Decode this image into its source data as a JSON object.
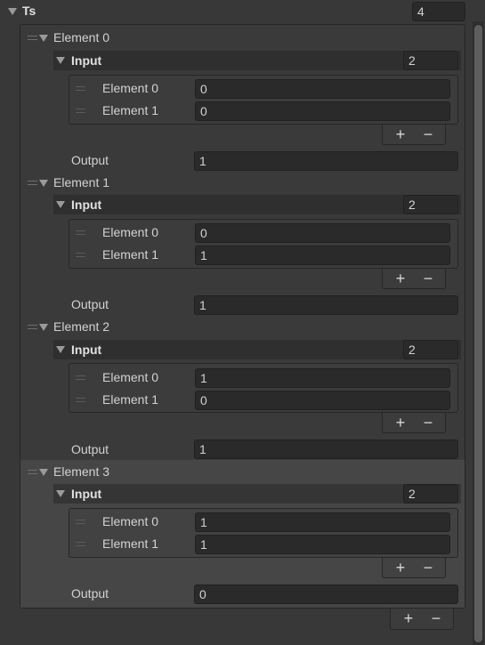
{
  "root": {
    "label": "Ts",
    "size": "4"
  },
  "elements": [
    {
      "label": "Element 0",
      "input_label": "Input",
      "input_size": "2",
      "items": [
        {
          "label": "Element 0",
          "value": "0"
        },
        {
          "label": "Element 1",
          "value": "0"
        }
      ],
      "output_label": "Output",
      "output_value": "1"
    },
    {
      "label": "Element 1",
      "input_label": "Input",
      "input_size": "2",
      "items": [
        {
          "label": "Element 0",
          "value": "0"
        },
        {
          "label": "Element 1",
          "value": "1"
        }
      ],
      "output_label": "Output",
      "output_value": "1"
    },
    {
      "label": "Element 2",
      "input_label": "Input",
      "input_size": "2",
      "items": [
        {
          "label": "Element 0",
          "value": "1"
        },
        {
          "label": "Element 1",
          "value": "0"
        }
      ],
      "output_label": "Output",
      "output_value": "1"
    },
    {
      "label": "Element 3",
      "input_label": "Input",
      "input_size": "2",
      "items": [
        {
          "label": "Element 0",
          "value": "1"
        },
        {
          "label": "Element 1",
          "value": "1"
        }
      ],
      "output_label": "Output",
      "output_value": "0"
    }
  ],
  "buttons": {
    "add": "+",
    "remove": "−"
  },
  "icons": {
    "foldout": "foldout-triangle-icon",
    "drag": "drag-handle-icon"
  },
  "colors": {
    "background": "#383838",
    "field": "#2a2a2a",
    "selected": "#464646"
  }
}
